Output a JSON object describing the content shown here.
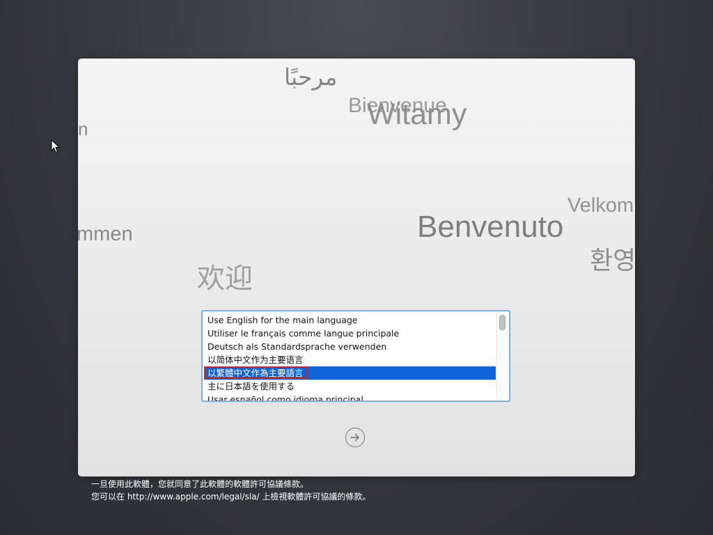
{
  "greetings": {
    "arabic": "مرحبًا",
    "french": "Bienvenue",
    "polish": "Witamy",
    "left_partial_1": "n",
    "left_partial_2": "mmen",
    "danish": "Velkom",
    "italian": "Benvenuto",
    "korean": "환영",
    "chinese": "欢迎"
  },
  "language_list": {
    "items": [
      {
        "label": "Use English for the main language"
      },
      {
        "label": "Utiliser le français comme langue principale"
      },
      {
        "label": "Deutsch als Standardsprache verwenden"
      },
      {
        "label": "以简体中文作为主要语言"
      },
      {
        "label": "以繁體中文作為主要語言",
        "selected": true
      },
      {
        "label": "主に日本語を使用する"
      },
      {
        "label": "Usar español como idioma principal"
      }
    ],
    "selected_index": 4
  },
  "next_button": {
    "icon": "arrow-right-circle-icon"
  },
  "footer": {
    "line1": "一旦使用此軟體，您就同意了此軟體的軟體許可協議條款。",
    "line2": "您可以在 http://www.apple.com/legal/sla/ 上檢視軟體許可協議的條款。"
  },
  "colors": {
    "selection": "#0f63d6",
    "focus_ring": "#7aaef5",
    "highlight_box": "#d42020"
  }
}
